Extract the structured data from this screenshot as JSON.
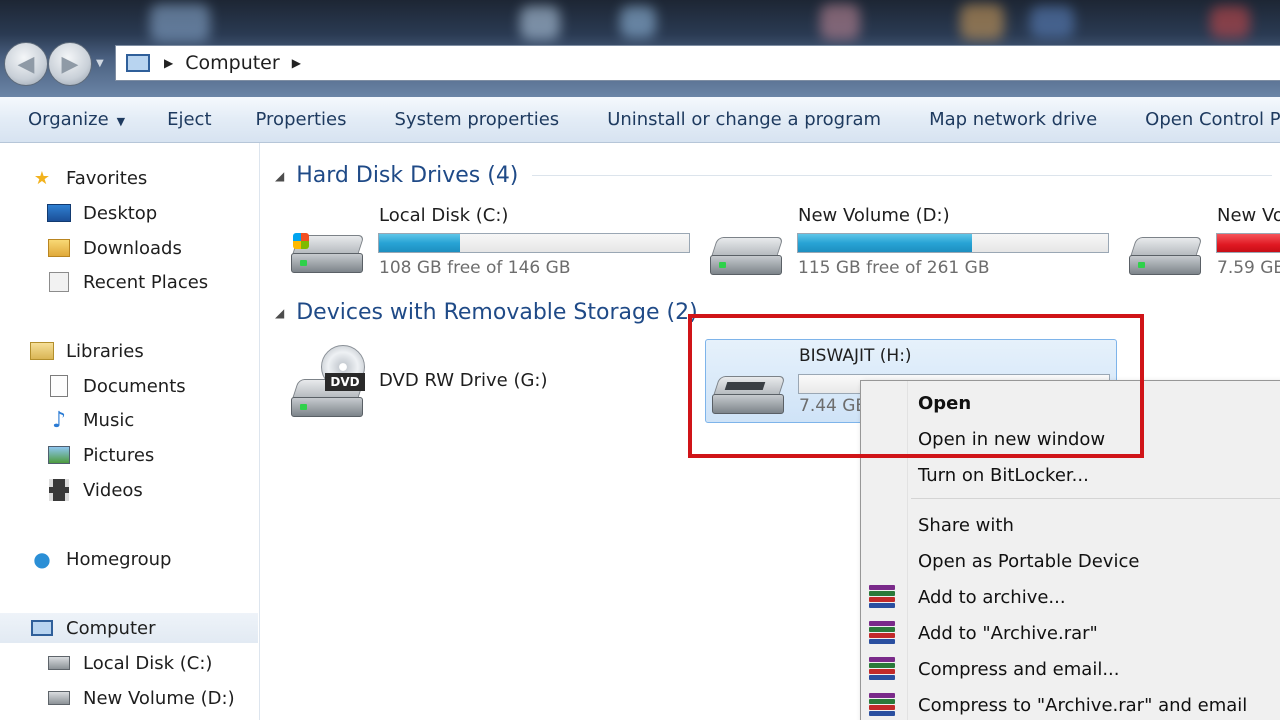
{
  "address": {
    "segments": [
      "Computer"
    ]
  },
  "toolbar": {
    "organize": "Organize",
    "eject": "Eject",
    "properties": "Properties",
    "system_properties": "System properties",
    "uninstall": "Uninstall or change a program",
    "map_network": "Map network drive",
    "open_control_panel": "Open Control Pa"
  },
  "nav": {
    "favorites": "Favorites",
    "desktop": "Desktop",
    "downloads": "Downloads",
    "recent": "Recent Places",
    "libraries": "Libraries",
    "documents": "Documents",
    "music": "Music",
    "pictures": "Pictures",
    "videos": "Videos",
    "homegroup": "Homegroup",
    "computer": "Computer",
    "local_c": "Local Disk (C:)",
    "new_d": "New Volume (D:)"
  },
  "groups": {
    "hdd": "Hard Disk Drives (4)",
    "removable": "Devices with Removable Storage (2)"
  },
  "drives": {
    "c": {
      "name": "Local Disk (C:)",
      "free": "108 GB free of 146 GB",
      "used_fraction": 0.26
    },
    "d": {
      "name": "New Volume (D:)",
      "free": "115 GB free of 261 GB",
      "used_fraction": 0.56
    },
    "e": {
      "name": "New Vo",
      "free": "7.59 GB",
      "used_fraction": 0.9
    },
    "g": {
      "name": "DVD RW Drive (G:)",
      "icon_label": "DVD"
    },
    "h": {
      "name": "BISWAJIT (H:)",
      "free": "7.44 GB",
      "used_fraction": 0.0
    }
  },
  "menu": {
    "open": "Open",
    "open_new": "Open in new window",
    "bitlocker": "Turn on BitLocker...",
    "share": "Share with",
    "portable": "Open as Portable Device",
    "add_archive": "Add to archive...",
    "add_rar": "Add to \"Archive.rar\"",
    "compress_email": "Compress and email...",
    "compress_rar_email": "Compress to \"Archive.rar\" and email"
  },
  "colors": {
    "accent_red": "#d01418",
    "bar_blue": "#28a3d5",
    "bar_red": "#e01822"
  }
}
